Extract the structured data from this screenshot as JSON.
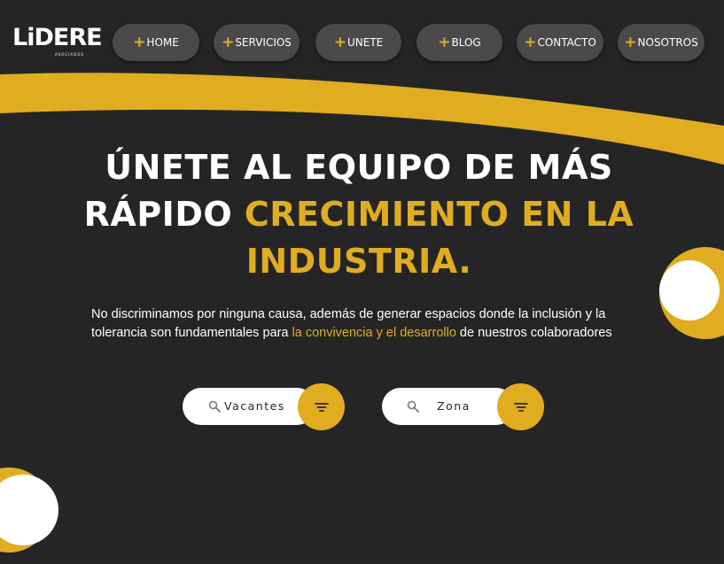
{
  "brand": {
    "name": "LiDERE",
    "subtitle": "ASOCIADOS"
  },
  "nav": [
    {
      "label": "HOME"
    },
    {
      "label": "SERVICIOS"
    },
    {
      "label": "UNETE"
    },
    {
      "label": "BLOG"
    },
    {
      "label": "CONTACTO"
    },
    {
      "label": "NOSOTROS"
    }
  ],
  "hero": {
    "line1": "ÚNETE AL EQUIPO DE MÁS",
    "line2_white": "RÁPIDO ",
    "line2_accent": "CRECIMIENTO EN LA",
    "line3_accent": "INDUSTRIA.",
    "desc_part1": "No discriminamos por ninguna causa, además de generar espacios donde la inclusión y la tolerancia son fundamentales para ",
    "desc_accent": "la convivencia y el desarrollo",
    "desc_part2": " de nuestros colaboradores"
  },
  "filters": [
    {
      "label": "Vacantes",
      "icon": "search-icon"
    },
    {
      "label": "Zona",
      "icon": "search-icon"
    }
  ],
  "colors": {
    "accent": "#e0ad21",
    "background": "#262526",
    "nav_button": "#4a4a4b"
  }
}
